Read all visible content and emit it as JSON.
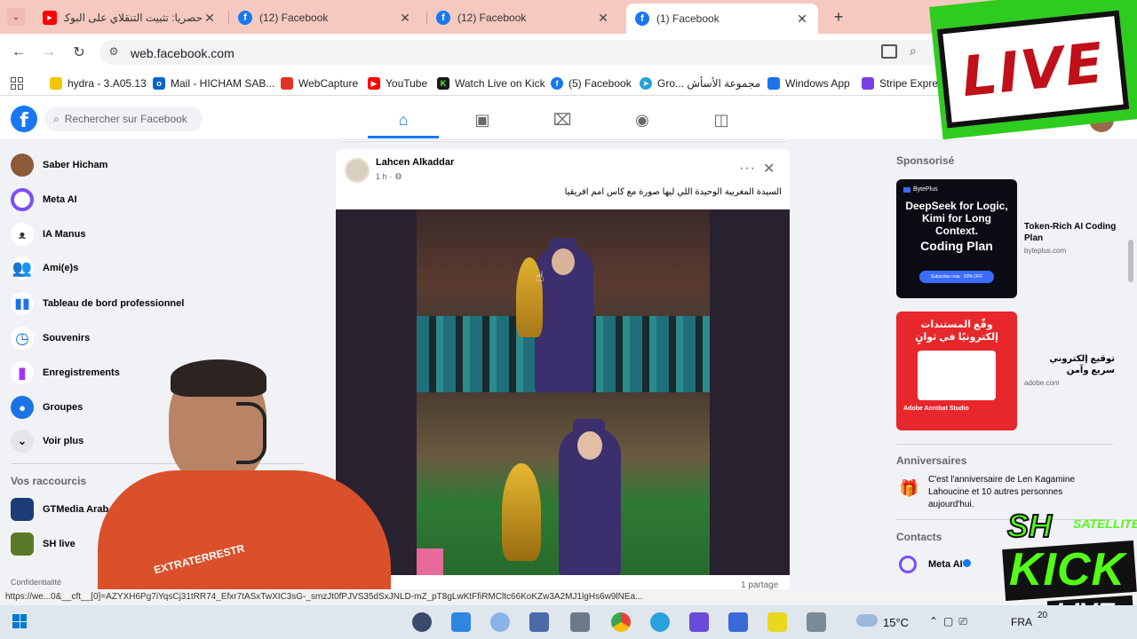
{
  "browser": {
    "tabs": [
      {
        "title": "حصريا: تثبيت التنقلاي على البوكس",
        "icon": "youtube-icon"
      },
      {
        "title": "(12) Facebook",
        "icon": "facebook-icon"
      },
      {
        "title": "(12) Facebook",
        "icon": "facebook-icon"
      },
      {
        "title": "(1) Facebook",
        "icon": "facebook-icon",
        "active": true
      }
    ],
    "url": "web.facebook.com",
    "bookmarks": [
      {
        "label": "hydra - 3.A05.13",
        "color": "#f2c600"
      },
      {
        "label": "Mail - HICHAM SAB...",
        "color": "#0a64c8"
      },
      {
        "label": "WebCapture",
        "color": "#e0342a"
      },
      {
        "label": "YouTube",
        "color": "#ff0000"
      },
      {
        "label": "Watch Live on Kick",
        "color": "#1a1a1a"
      },
      {
        "label": "(5) Facebook",
        "color": "#1877f2"
      },
      {
        "label": "Gro... مجموعة الأسأش",
        "color": "#2aa1da"
      },
      {
        "label": "Windows App",
        "color": "#1a73e8"
      },
      {
        "label": "Stripe Express",
        "color": "#7b3fe4"
      }
    ],
    "status_url": "https://we...0&__cft__[0]=AZYXH6Pg7iYqsCj31tRR74_Efxr7tASxTwXIC3sG-_smzJt0fPJVS35dSxJNLD-mZ_pT8gLwKtFfiRMCltc66KoKZw3A2MJ1lgHs6w9lNEa..."
  },
  "facebook": {
    "search_placeholder": "Rechercher sur Facebook",
    "sidebar": [
      {
        "label": "Saber Hicham",
        "icon": "avatar",
        "color": "#8a5a3a"
      },
      {
        "label": "Meta AI",
        "icon": "meta-ai-icon",
        "color": "#7b4dff"
      },
      {
        "label": "IA Manus",
        "icon": "manus-icon",
        "color": "#333333"
      },
      {
        "label": "Ami(e)s",
        "icon": "friends-icon",
        "color": "#1b74e4"
      },
      {
        "label": "Tableau de bord professionnel",
        "icon": "dashboard-icon",
        "color": "#1b74e4"
      },
      {
        "label": "Souvenirs",
        "icon": "memories-icon",
        "color": "#1b74e4"
      },
      {
        "label": "Enregistrements",
        "icon": "saved-icon",
        "color": "#a033ff"
      },
      {
        "label": "Groupes",
        "icon": "groups-icon",
        "color": "#1b74e4"
      },
      {
        "label": "Voir plus",
        "icon": "chevron-down-icon",
        "color": "#e4e6eb"
      }
    ],
    "shortcuts_title": "Vos raccourcis",
    "shortcuts": [
      {
        "label": "GTMedia Arab & Eu",
        "color": "#1c3c78"
      },
      {
        "label": "SH live",
        "color": "#5a7a2a"
      }
    ],
    "footer_text": "Confidentialité",
    "post": {
      "author": "Lahcen Alkaddar",
      "time": "1 h",
      "text": "السيدة المغربية الوحيدة اللي ليها صورة مع كاس امم افريقيا",
      "shares": "1 partage"
    },
    "right": {
      "sponsored_title": "Sponsorisé",
      "ads": [
        {
          "title": "Token-Rich AI Coding Plan",
          "domain": "byteplus.com",
          "brand": "BytePlus",
          "headline": "DeepSeek for Logic, Kimi for Long Context.",
          "plan": "Coding Plan",
          "cta": "Subscribe now · 50% OFF"
        },
        {
          "title": "توقيع إلكتروني سريع وآمن",
          "domain": "adobe.com",
          "headline": "وقّع المستندات إلكترونيًا في ثوانٍ",
          "brand": "Adobe Acrobat Studio"
        }
      ],
      "birthdays_title": "Anniversaires",
      "birthday_text": "C'est l'anniversaire de Len Kagamine Lahoucine et 10 autres personnes aujourd'hui.",
      "contacts_title": "Contacts",
      "contact": "Meta AI"
    }
  },
  "overlay": {
    "live_badge": "LIVE",
    "kick_logo": {
      "top": "SH",
      "sub": "SATELLITE",
      "brand": "KICK",
      "live": "LIVE"
    },
    "shirt_text": "EXTRATERRESTR"
  },
  "taskbar": {
    "weather": "15°C",
    "lang": "FRA",
    "clock": "20"
  }
}
